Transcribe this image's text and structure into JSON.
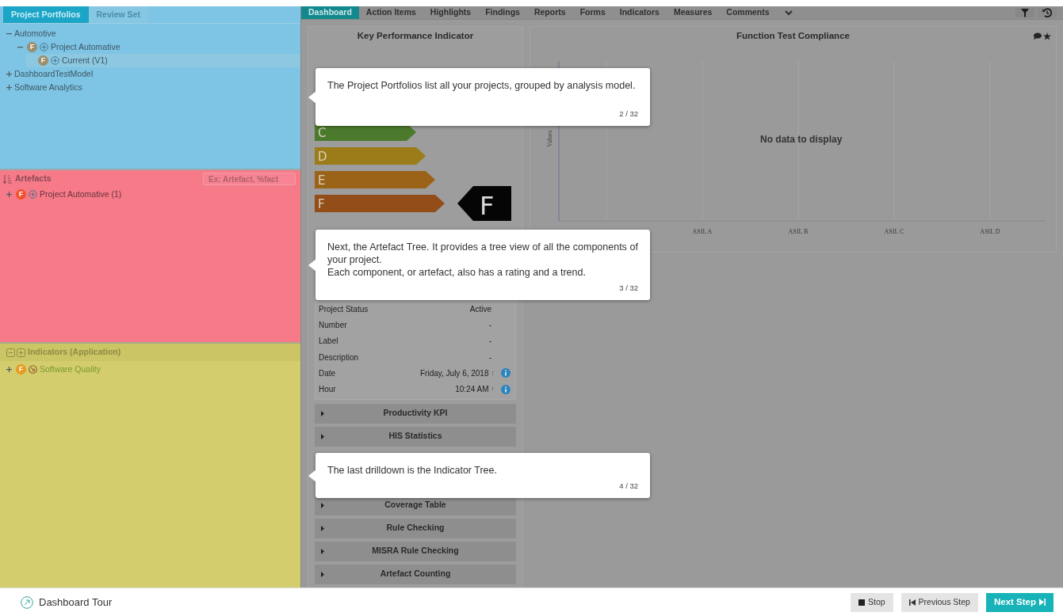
{
  "portfolio_tabs": [
    {
      "label": "Project Portfolios",
      "selected": true
    },
    {
      "label": "Review Set",
      "selected": false
    }
  ],
  "portfolio_tree": [
    {
      "label": "Automotive",
      "expanded": true,
      "selected": false,
      "children": [
        {
          "label": "Project Automative",
          "rating": "F",
          "expanded": true,
          "selected": false,
          "children": [
            {
              "label": "Current (V1)",
              "rating": "F",
              "selected": true
            }
          ]
        }
      ]
    },
    {
      "label": "DashboardTestModel",
      "expanded": false,
      "selected": false
    },
    {
      "label": "Software Analytics",
      "expanded": false,
      "selected": false
    }
  ],
  "artefacts": {
    "title": "Artefacts",
    "search_placeholder": "Ex: Artefact, %fact",
    "tree": [
      {
        "label": "Project Automative (1)",
        "rating": "F",
        "expanded": false,
        "selected": false
      }
    ]
  },
  "indicators": {
    "title": "Indicators (Application)",
    "tree": [
      {
        "label": "Software Quality",
        "rating": "F",
        "expanded": false,
        "selected": false
      }
    ]
  },
  "nav_tabs": [
    {
      "label": "Dashboard",
      "selected": true
    },
    {
      "label": "Action Items",
      "selected": false
    },
    {
      "label": "Highlights",
      "selected": false
    },
    {
      "label": "Findings",
      "selected": false
    },
    {
      "label": "Reports",
      "selected": false
    },
    {
      "label": "Forms",
      "selected": false
    },
    {
      "label": "Indicators",
      "selected": false
    },
    {
      "label": "Measures",
      "selected": false
    },
    {
      "label": "Comments",
      "selected": false
    }
  ],
  "kpi": {
    "title": "Key Performance Indicator",
    "rating": "F",
    "bars": [
      {
        "letter": "C",
        "color": "#4b7a2c",
        "selected": false
      },
      {
        "letter": "D",
        "color": "#9c7b19",
        "selected": false
      },
      {
        "letter": "E",
        "color": "#9a6317",
        "selected": false
      },
      {
        "letter": "F",
        "color": "#934d18",
        "selected": true
      }
    ],
    "info": [
      {
        "label": "Project Status",
        "value": "Active"
      },
      {
        "label": "Number",
        "value": "-"
      },
      {
        "label": "Label",
        "value": "-"
      },
      {
        "label": "Description",
        "value": "-"
      },
      {
        "label": "Date",
        "value": "Friday, July 6, 2018",
        "trend": "↑",
        "info": true
      },
      {
        "label": "Hour",
        "value": "10:24 AM",
        "trend": "↑",
        "info": true
      }
    ],
    "section_groups": [
      [
        {
          "label": "Productivity KPI"
        },
        {
          "label": "HIS Statistics"
        }
      ],
      [
        {
          "label": "Coverage Table"
        },
        {
          "label": "Rule Checking"
        },
        {
          "label": "MISRA Rule Checking"
        },
        {
          "label": "Artefact Counting"
        }
      ]
    ]
  },
  "chart": {
    "title": "Function Test Compliance",
    "ylabel": "Values",
    "categories": [
      "ASIL A",
      "ASIL B",
      "ASIL C",
      "ASIL D"
    ],
    "message": "No data to display"
  },
  "tour_steps": [
    {
      "paragraphs": [
        "The Project Portfolios list all your projects, grouped by analysis model."
      ],
      "step": "2 / 32"
    },
    {
      "paragraphs": [
        "Next, the Artefact Tree. It provides a tree view of all the components of your project.",
        "Each component, or artefact, also has a rating and a trend."
      ],
      "step": "3 / 32"
    },
    {
      "paragraphs": [
        "The last drilldown is the Indicator Tree."
      ],
      "step": "4 / 32"
    }
  ],
  "footer": {
    "title": "Dashboard Tour",
    "buttons": [
      {
        "label": "Stop",
        "kind": "stop"
      },
      {
        "label": "Previous Step",
        "kind": "previous"
      },
      {
        "label": "Next Step",
        "kind": "next"
      }
    ]
  }
}
